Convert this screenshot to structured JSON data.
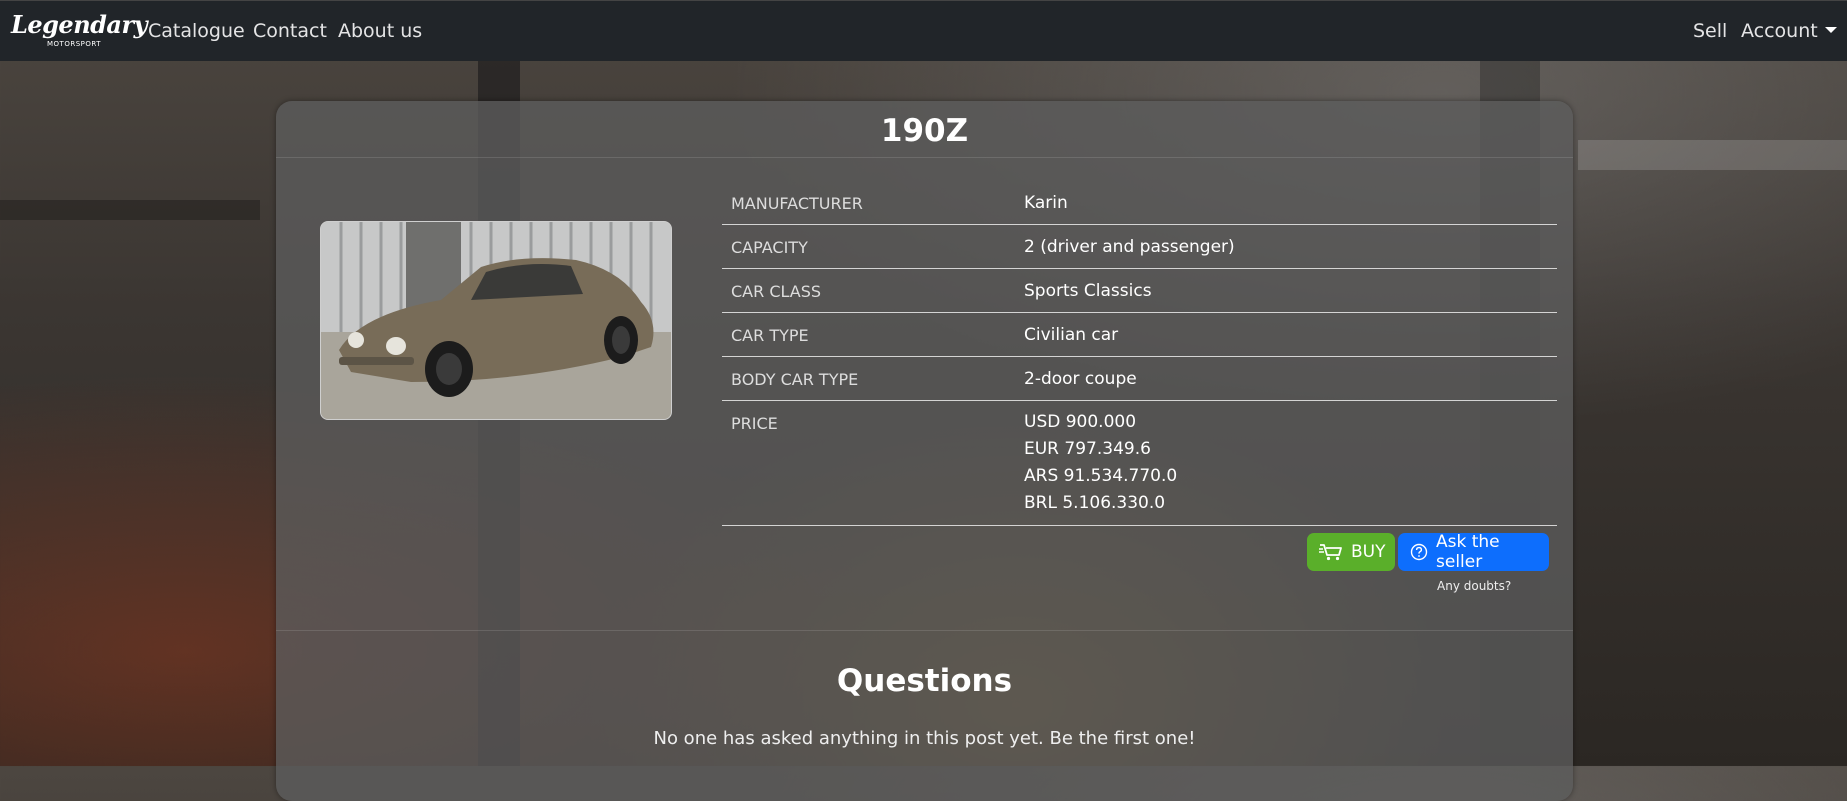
{
  "nav": {
    "brand_main": "Legendary",
    "brand_sub": "MOTORSPORT",
    "links": [
      "Catalogue",
      "Contact",
      "About us"
    ],
    "sell": "Sell",
    "account": "Account"
  },
  "car": {
    "title": "190Z",
    "specs": [
      {
        "label": "MANUFACTURER",
        "value": "Karin"
      },
      {
        "label": "CAPACITY",
        "value": "2 (driver and passenger)"
      },
      {
        "label": "CAR CLASS",
        "value": "Sports Classics"
      },
      {
        "label": "CAR TYPE",
        "value": "Civilian car"
      },
      {
        "label": "BODY CAR TYPE",
        "value": "2-door coupe"
      }
    ],
    "price_label": "PRICE",
    "prices": [
      "USD 900.000",
      "EUR 797.349.6",
      "ARS 91.534.770.0",
      "BRL 5.106.330.0"
    ]
  },
  "actions": {
    "buy": "BUY",
    "ask": "Ask the seller",
    "hint": "Any doubts?"
  },
  "questions": {
    "title": "Questions",
    "empty": "No one has asked anything in this post yet. Be the first one!"
  },
  "colors": {
    "navbar": "#212529",
    "buy": "#5aaf2a",
    "ask": "#0d6efd"
  },
  "icons": [
    "cart-icon",
    "question-circle-icon",
    "caret-down-icon"
  ]
}
